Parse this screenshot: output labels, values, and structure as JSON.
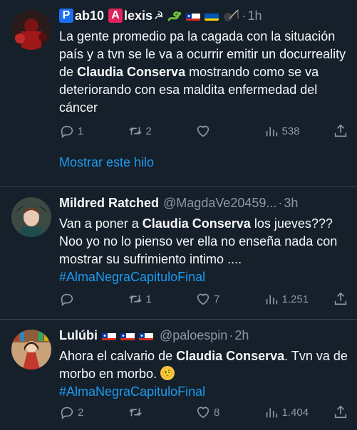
{
  "tweets": [
    {
      "badge1": "P",
      "name_mid": "ab10",
      "badge2": "A",
      "name_end": "lexis",
      "name_symbol": "☭",
      "time": "1h",
      "text_part1": "La gente promedio pa la cagada con la situación país y a tvn se le va a ocurrir emitir  un  docurreality de ",
      "text_bold": "Claudia Conserva",
      "text_part2": " mostrando como se va deteriorando con esa maldita enfermedad del cáncer",
      "replies": "1",
      "retweets": "2",
      "likes": "",
      "views": "538",
      "thread_link": "Mostrar este hilo"
    },
    {
      "name": "Mildred Ratched",
      "handle": "@MagdaVe20459...",
      "time": "3h",
      "text_part1": "Van a poner a ",
      "text_bold": "Claudia Conserva",
      "text_part2": " los jueves??? Noo yo no lo pienso ver ella no enseña nada con mostrar su sufrimiento intimo ....",
      "hashtag": "#AlmaNegraCapituloFinal",
      "replies": "",
      "retweets": "1",
      "likes": "7",
      "views": "1.251"
    },
    {
      "name": "Lulúbi",
      "handle": "@paloespin",
      "time": "2h",
      "text_part1": "Ahora el calvario de ",
      "text_bold": "Claudia Conserva",
      "text_part2": ". Tvn va de morbo en morbo. ",
      "text_emoji": "🤨",
      "hashtag": "#AlmaNegraCapituloFinal",
      "replies": "2",
      "retweets": "",
      "likes": "8",
      "views": "1.404"
    }
  ],
  "colors": {
    "background": "#15202b",
    "text": "#f7f9f9",
    "muted": "#8b98a5",
    "link": "#1d9bf0",
    "badge_p": "#1d6ff2",
    "badge_a": "#e0245e",
    "divider": "#38444d"
  }
}
